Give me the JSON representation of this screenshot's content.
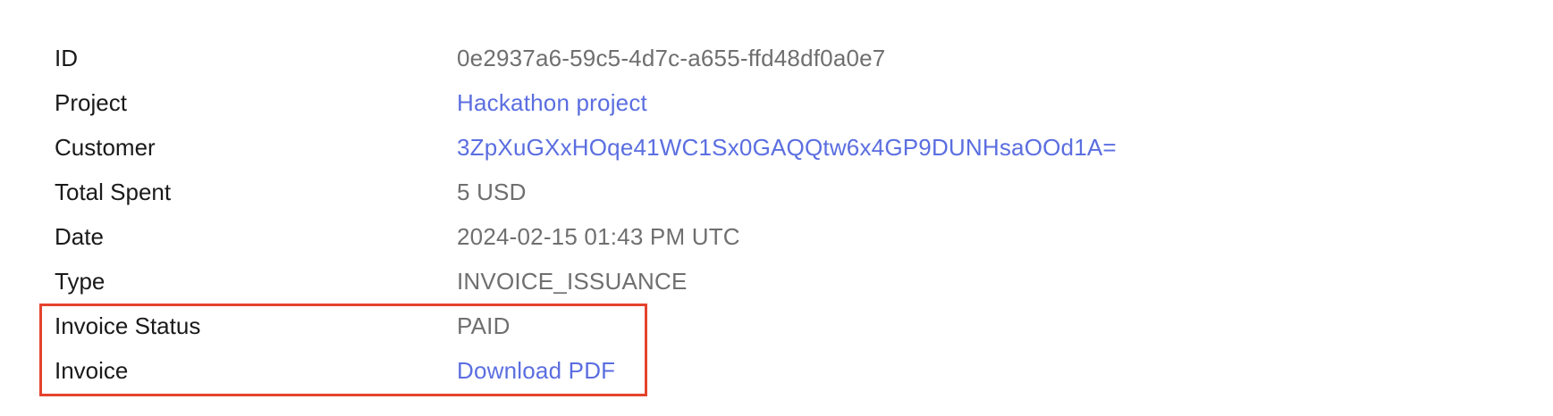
{
  "details": {
    "rows": [
      {
        "label": "ID",
        "value": "0e2937a6-59c5-4d7c-a655-ffd48df0a0e7"
      },
      {
        "label": "Project",
        "value": "Hackathon project"
      },
      {
        "label": "Customer",
        "value": "3ZpXuGXxHOqe41WC1Sx0GAQQtw6x4GP9DUNHsaOOd1A="
      },
      {
        "label": "Total Spent",
        "value": "5 USD"
      },
      {
        "label": "Date",
        "value": "2024-02-15 01:43 PM UTC"
      },
      {
        "label": "Type",
        "value": "INVOICE_ISSUANCE"
      },
      {
        "label": "Invoice Status",
        "value": "PAID"
      },
      {
        "label": "Invoice",
        "value": "Download PDF"
      }
    ]
  },
  "colors": {
    "label_text": "#1a1a1a",
    "value_text": "#6f6f6f",
    "link": "#5b6ee0",
    "highlight_border": "#e5432d"
  }
}
